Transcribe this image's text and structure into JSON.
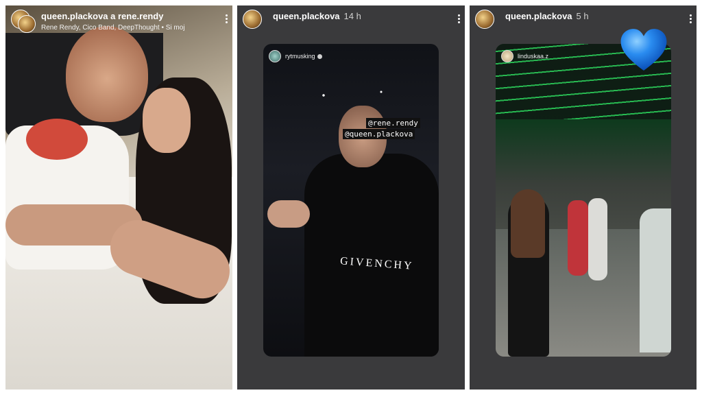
{
  "panels": [
    {
      "username": "queen.plackova a rene.rendy",
      "subtitle": "Rene Rendy, Cico Band, DeepThought • Si moj",
      "time": ""
    },
    {
      "username": "queen.plackova",
      "time": "14 h",
      "card": {
        "username": "rytmusking",
        "verified": true,
        "mentions": [
          "@rene.rendy",
          "@queen.plackova"
        ],
        "shirt_text": "GIVENCHY"
      }
    },
    {
      "username": "queen.plackova",
      "time": "5 h",
      "card": {
        "username": "linduskaa.z"
      },
      "sticker": "blue-heart"
    }
  ],
  "colors": {
    "panel_bg": "#3a3a3c",
    "heart": "#1f7fe8",
    "text": "#ffffff"
  }
}
